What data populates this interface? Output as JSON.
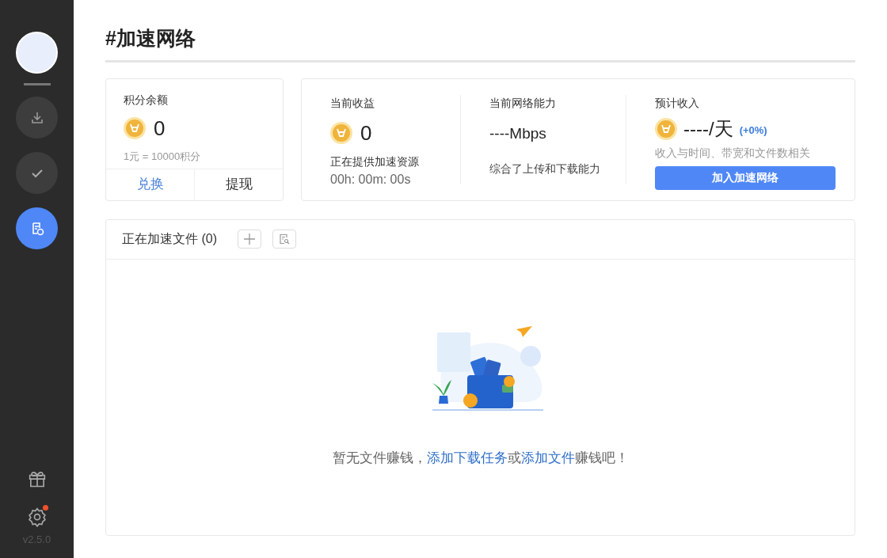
{
  "sidebar": {
    "nav": [
      {
        "kind": "download",
        "selected": false
      },
      {
        "kind": "done",
        "selected": false
      },
      {
        "kind": "accelerate",
        "selected": true
      }
    ],
    "bottom": [
      {
        "kind": "gift",
        "badge": false
      },
      {
        "kind": "settings",
        "badge": true
      }
    ],
    "version": "v2.5.0"
  },
  "page_title": "#加速网络",
  "balance": {
    "label": "积分余额",
    "value": "0",
    "rate": "1元 = 10000积分",
    "actions": [
      {
        "label": "兑换",
        "kind": "primary"
      },
      {
        "label": "提现",
        "kind": "plain"
      }
    ]
  },
  "earnings": {
    "label": "当前收益",
    "value": "0",
    "status": "正在提供加速资源",
    "timer": "00h: 00m: 00s"
  },
  "network": {
    "label": "当前网络能力",
    "value": "----Mbps",
    "note": "综合了上传和下载能力"
  },
  "forecast": {
    "label": "预计收入",
    "value": "----/天",
    "change": "(+0%)",
    "note": "收入与时间、带宽和文件数相关",
    "button": "加入加速网络"
  },
  "files": {
    "title": "正在加速文件 (0)",
    "empty_message": [
      {
        "kind": "plain",
        "text": "暂无文件赚钱，"
      },
      {
        "kind": "link",
        "text": "添加下载任务"
      },
      {
        "kind": "plain",
        "text": "或"
      },
      {
        "kind": "link",
        "text": "添加文件"
      },
      {
        "kind": "plain",
        "text": "赚钱吧！"
      }
    ]
  }
}
